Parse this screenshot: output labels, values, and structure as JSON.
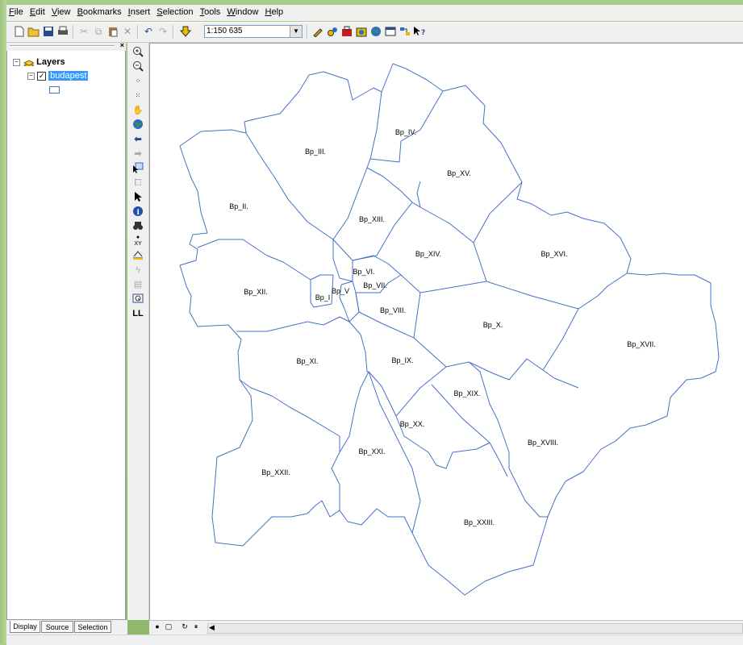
{
  "menu": [
    "File",
    "Edit",
    "View",
    "Bookmarks",
    "Insert",
    "Selection",
    "Tools",
    "Window",
    "Help"
  ],
  "menu_accel": [
    "F",
    "E",
    "V",
    "B",
    "I",
    "S",
    "T",
    "W",
    "H"
  ],
  "toolbar": {
    "scale_value": "1:150 635"
  },
  "toc": {
    "root_label": "Layers",
    "layer_label": "budapest",
    "tabs": [
      "Display",
      "Source",
      "Selection"
    ]
  },
  "map": {
    "outline_color": "#4472c4",
    "districts": [
      {
        "label": "Bp_IV."
      },
      {
        "label": "Bp_XV."
      },
      {
        "label": "Bp_III."
      },
      {
        "label": "Bp_II."
      },
      {
        "label": "Bp_XIII."
      },
      {
        "label": "Bp_XIV."
      },
      {
        "label": "Bp_XVI."
      },
      {
        "label": "Bp_VI."
      },
      {
        "label": "Bp_V"
      },
      {
        "label": "Bp_VII."
      },
      {
        "label": "Bp_XII."
      },
      {
        "label": "Bp_I"
      },
      {
        "label": "Bp_VIII."
      },
      {
        "label": "Bp_X."
      },
      {
        "label": "Bp_XVII."
      },
      {
        "label": "Bp_XI."
      },
      {
        "label": "Bp_IX."
      },
      {
        "label": "Bp_XIX."
      },
      {
        "label": "Bp_XX."
      },
      {
        "label": "Bp_XVIII."
      },
      {
        "label": "Bp_XXI."
      },
      {
        "label": "Bp_XXII."
      },
      {
        "label": "Bp_XXIII."
      }
    ]
  }
}
